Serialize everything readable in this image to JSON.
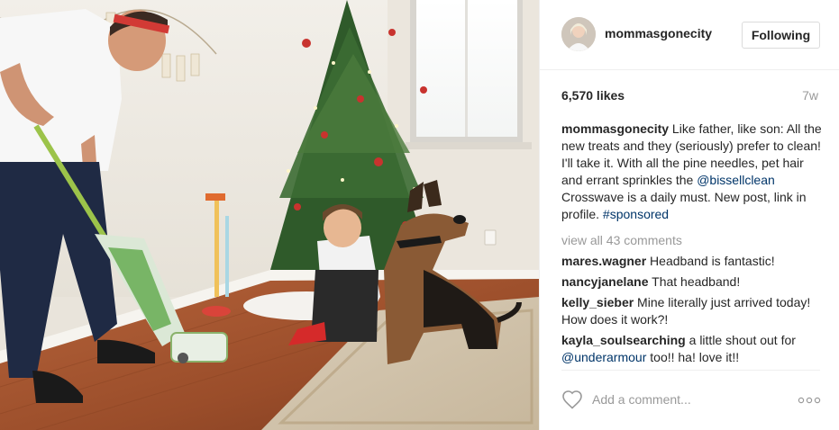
{
  "header": {
    "username": "mommasgonecity",
    "follow_label": "Following"
  },
  "stats": {
    "likes": "6,570 likes",
    "age": "7w"
  },
  "caption": {
    "username": "mommasgonecity",
    "text_1": " Like father, like son: All the new treats and they (seriously) prefer to clean! I'll take it. With all the pine needles, pet hair and errant sprinkles the ",
    "mention": "@bissellclean",
    "text_2": " Crosswave is a daily must. New post, link in profile. ",
    "hashtag": "#sponsored"
  },
  "view_all": "view all 43 comments",
  "comments": [
    {
      "username": "mares.wagner",
      "text": " Headband is fantastic!"
    },
    {
      "username": "nancyjanelane",
      "text": " That headband!"
    },
    {
      "username": "kelly_sieber",
      "text": " Mine literally just arrived today! How does it work?!"
    },
    {
      "username": "kayla_soulsearching",
      "text": " a little shout out for ",
      "mention": "@underarmour",
      "text_2": " too!! ha! love it!!"
    }
  ],
  "add_comment": {
    "placeholder": "Add a comment..."
  },
  "icons": {
    "like": "heart-outline-icon",
    "more": "more-options-icon"
  },
  "colors": {
    "link": "#003569",
    "muted": "#999999",
    "border": "#efefef"
  }
}
